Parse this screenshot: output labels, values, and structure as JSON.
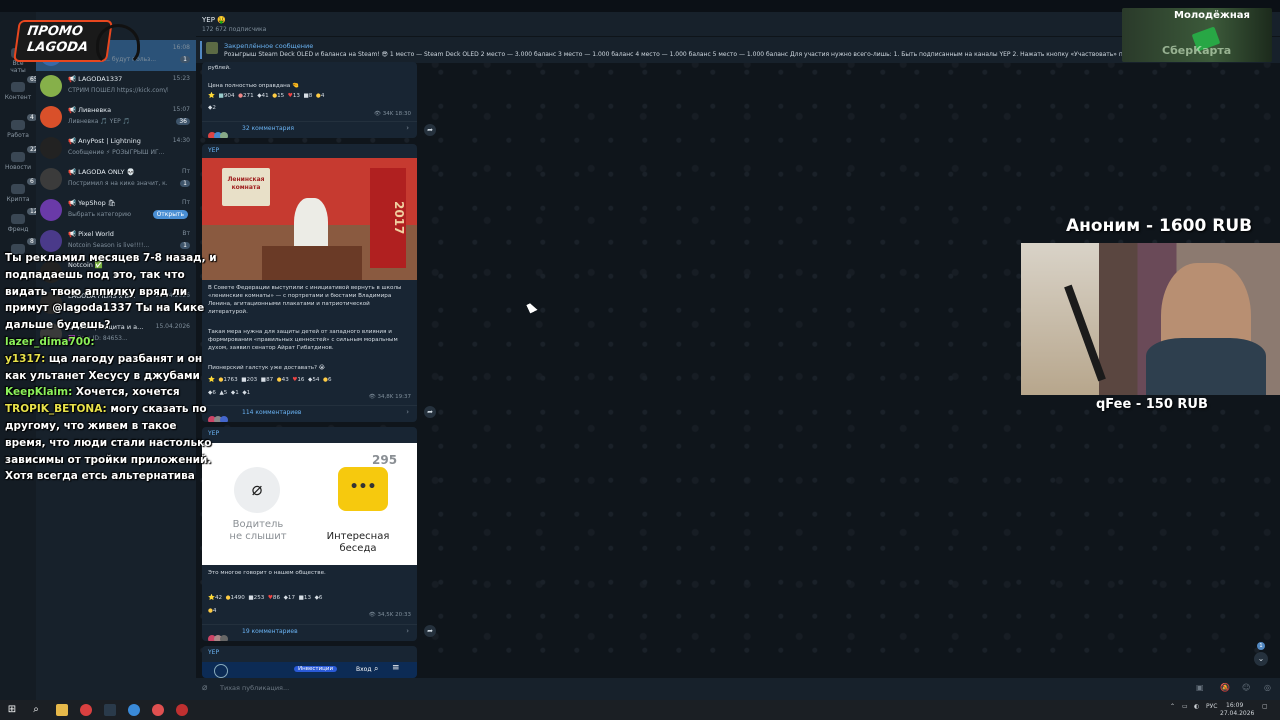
{
  "channel": {
    "title": "YEP 🤑",
    "subtitle": "172 672 подписчика"
  },
  "pinned": {
    "label": "Закреплённое сообщение",
    "text": "Розыгрыш Steam Deck OLED и баланса на Steam! 😎 1 место — Steam Deck OLED 2 место — 3.000 баланс 3 место — 1.000 баланс 4 место — 1.000 баланс 5 место — 1.000 баланс Для участия нужно всего-лишь: 1. Быть подписанным на каналы YEP 2. Нажать кнопку «Участвовать» под эт"
  },
  "rail": [
    {
      "label": "Все чаты",
      "badge": ""
    },
    {
      "label": "Контент",
      "badge": "65"
    },
    {
      "label": "Работа",
      "badge": "4"
    },
    {
      "label": "Новости",
      "badge": "22"
    },
    {
      "label": "Крипта",
      "badge": "6"
    },
    {
      "label": "Френд",
      "badge": "12"
    },
    {
      "label": "",
      "badge": "8"
    }
  ],
  "chats": [
    {
      "name": "",
      "preview": "Российские... будут польз...",
      "time": "16:08",
      "count": "1",
      "color": "#3a6aa8"
    },
    {
      "name": "📢 LAGODA1337",
      "preview": "СТРИМ ПОШЕЛ https://kick.com/lag...",
      "time": "15:23",
      "count": "",
      "color": "#86b04a"
    },
    {
      "name": "📢 Ливневка",
      "preview": "Ливневка 🎵 YEP 🎵",
      "time": "15:07",
      "count": "36",
      "color": "#d9502a"
    },
    {
      "name": "📢 AnyPost | Lightning",
      "preview": "Сообщение ⚡ РОЗЫГРЫШ ИГ...",
      "time": "14:30",
      "count": "",
      "color": "#222222"
    },
    {
      "name": "📢 LAGODA ONLY 💀",
      "preview": "Постримил я на кике значит, к...",
      "time": "Пт",
      "count": "1",
      "color": "#3b3b3b"
    },
    {
      "name": "📢 YepShop 🛍",
      "preview": "Выбрать категорию",
      "time": "Пт",
      "count": "",
      "color": "#6a3aa8",
      "button": "Открыть"
    },
    {
      "name": "📢 Pixel World",
      "preview": "Notcoin Season is live!!!!...",
      "time": "Вт",
      "count": "1",
      "color": "#4a3a8a"
    },
    {
      "name": "Notcoin ✅",
      "preview": "",
      "time": "",
      "count": "",
      "color": "#222222"
    },
    {
      "name": "LAGODA FILMS x B...",
      "preview": "",
      "time": "20.04.2026",
      "count": "",
      "color": "#2a2a2a"
    },
    {
      "name": "GladOS | Защита и а...",
      "preview": "🆔 Ваш ID: 84653...",
      "time": "15.04.2026",
      "count": "",
      "color": "#3a3a3a"
    }
  ],
  "post1": {
    "text_top": "рублей.",
    "text": "Цена полностью оправдана 🤏",
    "reactions": [
      "⭐",
      "904",
      "271",
      "41",
      "15",
      "13",
      "8",
      "4",
      "2"
    ],
    "views": "34K",
    "time": "18:30",
    "comments": "32 комментария"
  },
  "post2": {
    "channel": "YEP",
    "image_caption": "Ленинская комната",
    "image_year": "2017",
    "text1": "В Совете Федерации выступили с инициативой вернуть в школы «ленинские комнаты» — с портретами и бюстами Владимира Ленина, агитационными плакатами и патриотической литературой.",
    "text2": "Такая мера нужна для защиты детей от западного влияния и формирования «правильных ценностей» с сильным моральным духом, заявил сенатор Айрат Гибатдинов.",
    "text3": "Пионерский галстук уже доставать? 😭",
    "reactions": [
      "⭐",
      "1763",
      "203",
      "87",
      "43",
      "16",
      "54",
      "6",
      "6",
      "5",
      "1",
      "1"
    ],
    "views": "34,8K",
    "time": "19:37",
    "comments": "114 комментариев"
  },
  "post3": {
    "channel": "YEP",
    "left_label": "Водитель\nне слышит",
    "right_label": "Интересная\nбеседа",
    "right_count": "295",
    "text": "Это многое говорит о нашем обществе.",
    "reactions": [
      "⭐",
      "42",
      "1490",
      "253",
      "86",
      "17",
      "13",
      "6",
      "4"
    ],
    "views": "34,5K",
    "time": "20:33",
    "comments": "19 комментариев"
  },
  "post4": {
    "channel": "YEP",
    "badge": "Инвестиции",
    "login": "Вход"
  },
  "input": {
    "placeholder": "Тихая публикация..."
  },
  "overlay": {
    "promo_line1": "ПРОМО",
    "promo_line2": "LAGODA",
    "chat": [
      {
        "user": "",
        "text": "Ты рекламил месяцев 7-8 назад, и подпадаешь под это, так что видать твою аппилку вряд ли примут @lagoda1337 Ты на Кике дальше будешь?"
      },
      {
        "user": "lazer_dima700:",
        "text": ""
      },
      {
        "user": "y1317:",
        "text": " ща лагоду разбанят и он как ультанет Хесусу в джубами"
      },
      {
        "user": "KeepKlaim:",
        "text": " Хочется, хочется"
      },
      {
        "user": "TROPIK_BETONA:",
        "text": " могу сказать по другому, что живем в такое время, что люди стали настолько зависимы от тройки приложений. Хотя всегда етсь альтернатива"
      }
    ],
    "donate_title": "Аноним - 1600 RUB",
    "donate_sub": "qFee - 150 RUB",
    "ad_title": "Молодёжная",
    "ad_brand": "СберКарта"
  },
  "taskbar": {
    "lang": "РУС",
    "time": "16:09",
    "date": "27.04.2026"
  }
}
